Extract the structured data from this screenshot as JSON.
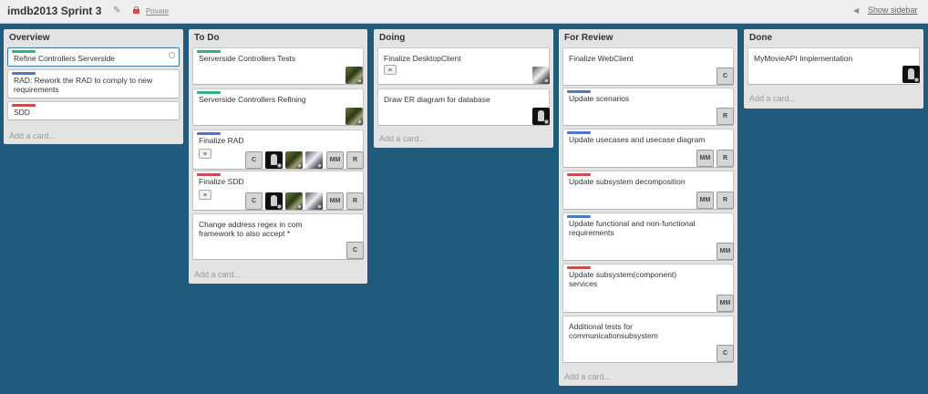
{
  "board": {
    "title": "imdb2013 Sprint 3",
    "visibility": "Private",
    "show_sidebar": "Show sidebar"
  },
  "lists": [
    {
      "title": "Overview",
      "add_card": "Add a card...",
      "cards": [
        {
          "title": "Refine Controllers Serverside",
          "label": "green",
          "selected": true
        },
        {
          "title": "RAD: Rework the RAD to comply to new requirements",
          "label": "blue"
        },
        {
          "title": "SDD",
          "label": "red"
        }
      ]
    },
    {
      "title": "To Do",
      "add_card": "Add a card...",
      "cards": [
        {
          "title": "Serverside Controllers Tests",
          "label": "green",
          "members": [
            "avatar"
          ]
        },
        {
          "title": "Serverside Controllers Refining",
          "label": "green",
          "members": [
            "avatar"
          ]
        },
        {
          "title": "Finalize RAD",
          "label": "blue",
          "members": [
            "C",
            "avatar",
            "avatar",
            "avatar",
            "MM",
            "R"
          ]
        },
        {
          "title": "Finalize SDD",
          "label": "red",
          "members": [
            "C",
            "avatar",
            "avatar",
            "avatar",
            "MM",
            "R"
          ]
        },
        {
          "title": "Change address regex in com framework to also accept *",
          "members": [
            "C"
          ]
        }
      ]
    },
    {
      "title": "Doing",
      "add_card": "Add a card...",
      "cards": [
        {
          "title": "Finalize DesktopClient",
          "members": [
            "avatar"
          ]
        },
        {
          "title": "Draw ER diagram for database",
          "members": [
            "avatar"
          ]
        }
      ]
    },
    {
      "title": "For Review",
      "add_card": "Add a card...",
      "cards": [
        {
          "title": "Finalize WebClient",
          "members": [
            "C"
          ]
        },
        {
          "title": "Update scenarios",
          "label": "blue",
          "members": [
            "R"
          ]
        },
        {
          "title": "Update usecases and usecase diagram",
          "label": "blue",
          "members": [
            "MM",
            "R"
          ]
        },
        {
          "title": "Update subsystem decomposition",
          "label": "red",
          "members": [
            "MM",
            "R"
          ]
        },
        {
          "title": "Update functional and non-functional requirements",
          "label": "blue",
          "members": [
            "MM"
          ]
        },
        {
          "title": "Update subsystem(component) services",
          "label": "red",
          "members": [
            "MM"
          ]
        },
        {
          "title": "Additional tests for communicationsubsystem",
          "members": [
            "C"
          ]
        }
      ]
    },
    {
      "title": "Done",
      "add_card": "Add a card...",
      "cards": [
        {
          "title": "MyMovieAPI Implementation",
          "members": [
            "avatar"
          ]
        }
      ]
    }
  ],
  "colors": {
    "background": "#205b7d",
    "list_bg": "#e3e3e3",
    "label_green": "#34b27d",
    "label_blue": "#4d77cb",
    "label_red": "#cb4d4d"
  }
}
